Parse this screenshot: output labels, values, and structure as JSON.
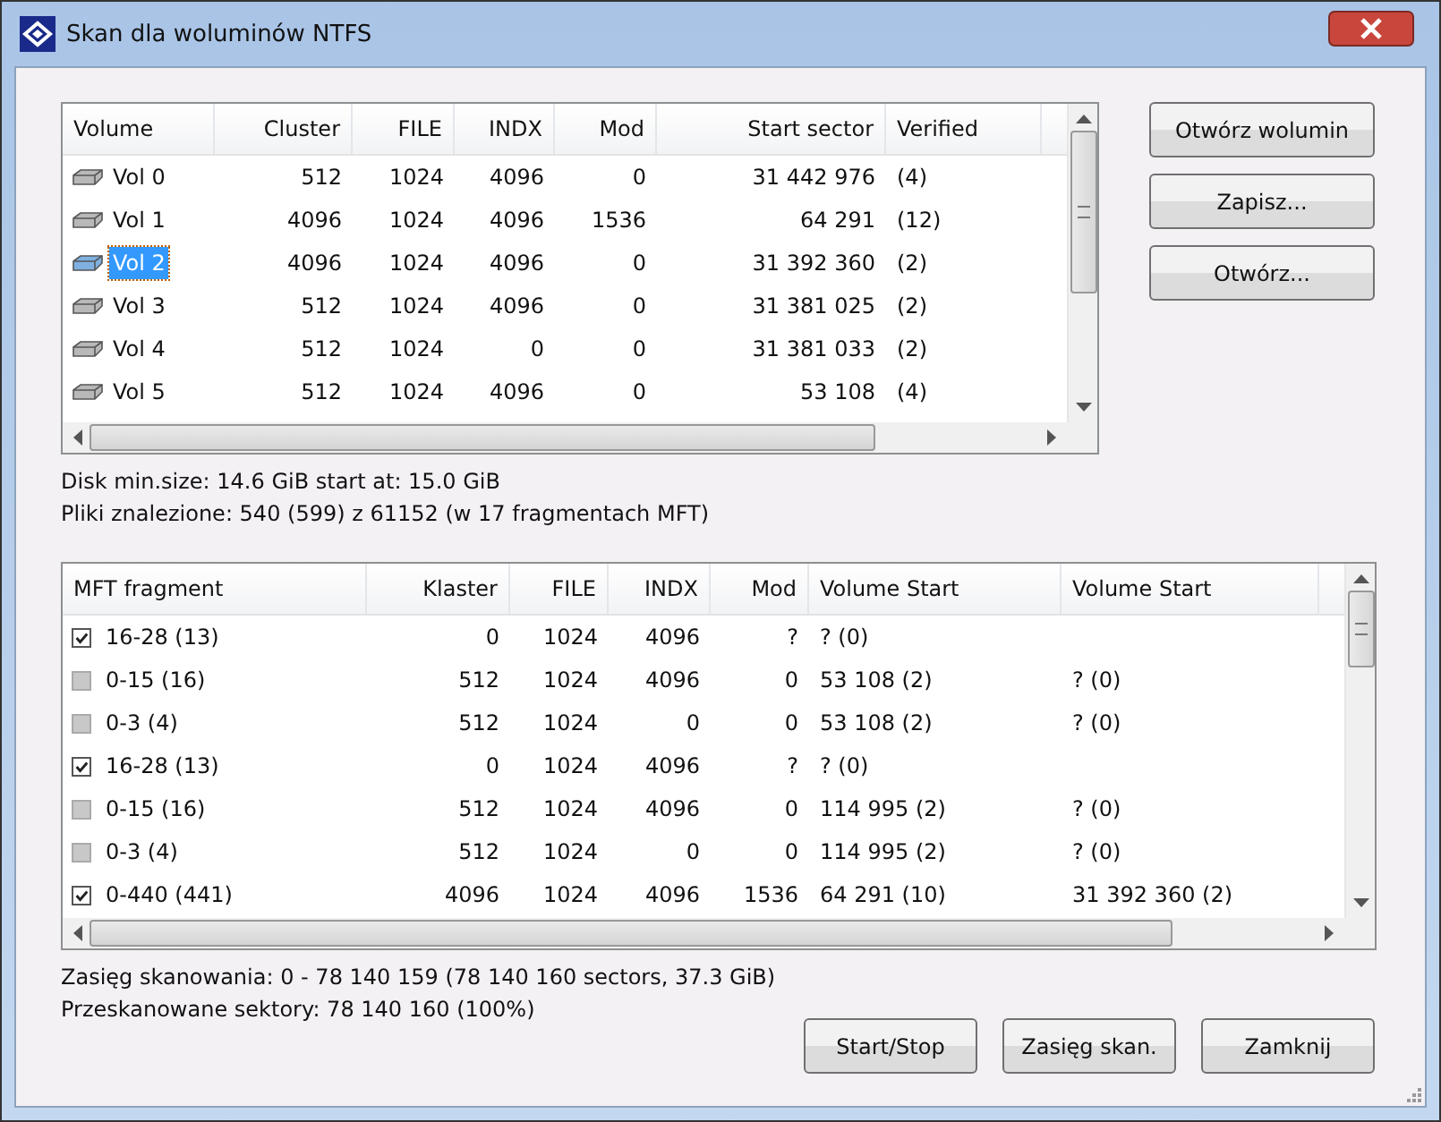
{
  "window": {
    "title": "Skan dla woluminów NTFS"
  },
  "volumes": {
    "columns": [
      "Volume",
      "Cluster",
      "FILE",
      "INDX",
      "Mod",
      "Start sector",
      "Verified"
    ],
    "rows": [
      {
        "cells": [
          "Vol 0",
          "512",
          "1024",
          "4096",
          "0",
          "31 442 976",
          "(4)"
        ],
        "selected": false
      },
      {
        "cells": [
          "Vol 1",
          "4096",
          "1024",
          "4096",
          "1536",
          "64 291",
          "(12)"
        ],
        "selected": false
      },
      {
        "cells": [
          "Vol 2",
          "4096",
          "1024",
          "4096",
          "0",
          "31 392 360",
          "(2)"
        ],
        "selected": true
      },
      {
        "cells": [
          "Vol 3",
          "512",
          "1024",
          "4096",
          "0",
          "31 381 025",
          "(2)"
        ],
        "selected": false
      },
      {
        "cells": [
          "Vol 4",
          "512",
          "1024",
          "0",
          "0",
          "31 381 033",
          "(2)"
        ],
        "selected": false
      },
      {
        "cells": [
          "Vol 5",
          "512",
          "1024",
          "4096",
          "0",
          "53 108",
          "(4)"
        ],
        "selected": false
      }
    ]
  },
  "side_buttons": [
    "Otwórz wolumin",
    "Zapisz...",
    "Otwórz..."
  ],
  "info_lines": [
    "Disk min.size: 14.6 GiB start at: 15.0 GiB",
    "Pliki znalezione: 540 (599) z 61152 (w 17 fragmentach MFT)"
  ],
  "fragments": {
    "columns": [
      "MFT fragment",
      "Klaster",
      "FILE",
      "INDX",
      "Mod",
      "Volume Start",
      "Volume Start"
    ],
    "rows": [
      {
        "cells": [
          "16-28 (13)",
          "0",
          "1024",
          "4096",
          "?",
          "? (0)",
          ""
        ],
        "checked": true
      },
      {
        "cells": [
          "0-15 (16)",
          "512",
          "1024",
          "4096",
          "0",
          "53 108 (2)",
          "? (0)"
        ],
        "checked": false
      },
      {
        "cells": [
          "0-3 (4)",
          "512",
          "1024",
          "0",
          "0",
          "53 108 (2)",
          "? (0)"
        ],
        "checked": false
      },
      {
        "cells": [
          "16-28 (13)",
          "0",
          "1024",
          "4096",
          "?",
          "? (0)",
          ""
        ],
        "checked": true
      },
      {
        "cells": [
          "0-15 (16)",
          "512",
          "1024",
          "4096",
          "0",
          "114 995 (2)",
          "? (0)"
        ],
        "checked": false
      },
      {
        "cells": [
          "0-3 (4)",
          "512",
          "1024",
          "0",
          "0",
          "114 995 (2)",
          "? (0)"
        ],
        "checked": false
      },
      {
        "cells": [
          "0-440 (441)",
          "4096",
          "1024",
          "4096",
          "1536",
          "64 291 (10)",
          "31 392 360 (2)"
        ],
        "checked": true
      }
    ]
  },
  "status_lines": [
    "Zasięg skanowania: 0 - 78 140 159 (78 140 160 sectors, 37.3 GiB)",
    "Przeskanowane sektory: 78 140 160 (100%)"
  ],
  "bottom_buttons": [
    "Start/Stop",
    "Zasięg skan.",
    "Zamknij"
  ]
}
